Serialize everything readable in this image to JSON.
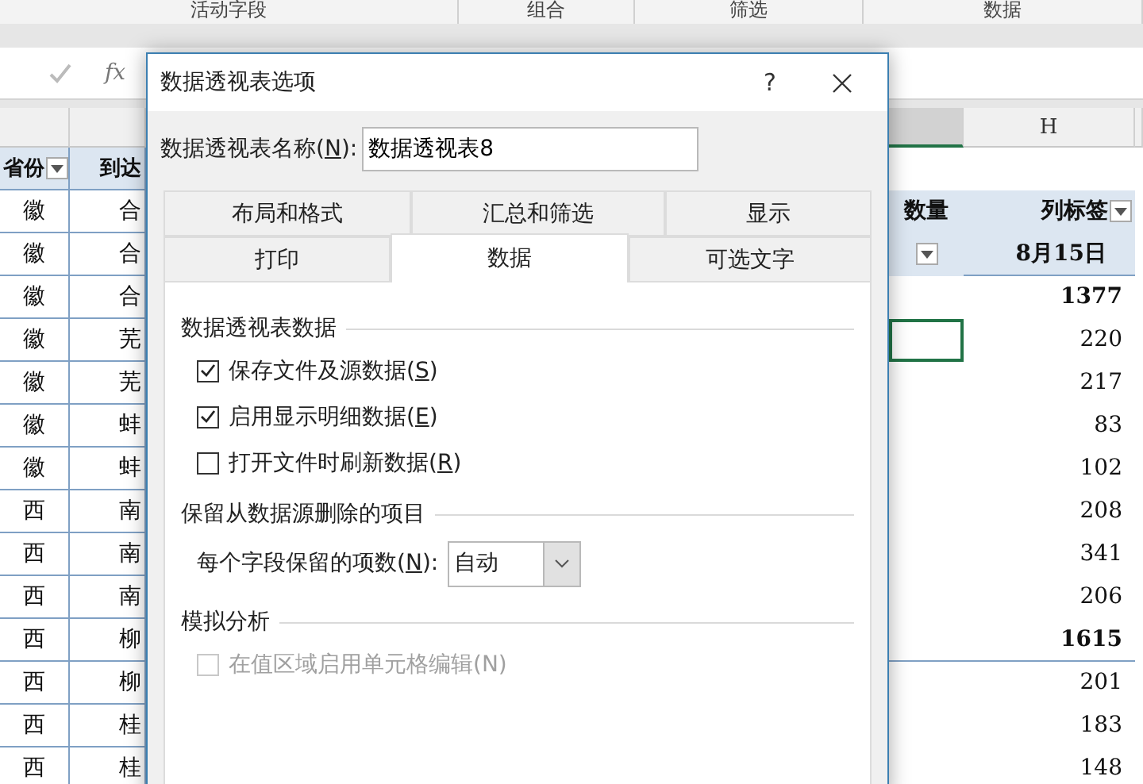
{
  "ribbon_groups": [
    "活动字段",
    "组合",
    "筛选",
    "数据"
  ],
  "formula_bar": {
    "function_label": "fx"
  },
  "left_table": {
    "headers": [
      {
        "text": "省份",
        "filter": true
      },
      {
        "text": "到达"
      }
    ],
    "rows": [
      [
        "徽",
        "合"
      ],
      [
        "徽",
        "合"
      ],
      [
        "徽",
        "合"
      ],
      [
        "徽",
        "芜"
      ],
      [
        "徽",
        "芜"
      ],
      [
        "徽",
        "蚌"
      ],
      [
        "徽",
        "蚌"
      ],
      [
        "西",
        "南"
      ],
      [
        "西",
        "南"
      ],
      [
        "西",
        "南"
      ],
      [
        "西",
        "柳"
      ],
      [
        "西",
        "柳"
      ],
      [
        "西",
        "桂"
      ],
      [
        "西",
        "桂"
      ]
    ]
  },
  "right_table": {
    "column_header": "H",
    "header_rows": [
      {
        "g_text": "数量",
        "h_text": "列标签",
        "h_filter": true
      },
      {
        "g_filter": true,
        "h_text": "8月15日"
      }
    ],
    "rows": [
      {
        "value": "1377",
        "bold": true,
        "selected": false
      },
      {
        "value": "220",
        "bold": false,
        "selected": true
      },
      {
        "value": "217",
        "bold": false,
        "selected": false
      },
      {
        "value": "83",
        "bold": false,
        "selected": false
      },
      {
        "value": "102",
        "bold": false,
        "selected": false
      },
      {
        "value": "208",
        "bold": false,
        "selected": false
      },
      {
        "value": "341",
        "bold": false,
        "selected": false
      },
      {
        "value": "206",
        "bold": false,
        "selected": false
      },
      {
        "value": "1615",
        "bold": true,
        "selected": false
      },
      {
        "value": "201",
        "bold": false,
        "selected": false
      },
      {
        "value": "183",
        "bold": false,
        "selected": false
      },
      {
        "value": "148",
        "bold": false,
        "selected": false
      }
    ]
  },
  "dialog": {
    "title": "数据透视表选项",
    "help": "?",
    "name_field": {
      "before": "数据透视表名称(",
      "accesskey": "N",
      "after": "):",
      "value": "数据透视表8"
    },
    "tab_rows": [
      [
        {
          "label": "布局和格式",
          "selected": false
        },
        {
          "label": "汇总和筛选",
          "selected": false
        },
        {
          "label": "显示",
          "selected": false
        }
      ],
      [
        {
          "label": "打印",
          "selected": false
        },
        {
          "label": "数据",
          "selected": true
        },
        {
          "label": "可选文字",
          "selected": false
        }
      ]
    ],
    "sections": [
      {
        "title": "数据透视表数据",
        "items": [
          {
            "kind": "checkbox",
            "before": "保存文件及源数据(",
            "accesskey": "S",
            "after": ")",
            "checked": true,
            "disabled": false
          },
          {
            "kind": "checkbox",
            "before": "启用显示明细数据(",
            "accesskey": "E",
            "after": ")",
            "checked": true,
            "disabled": false
          },
          {
            "kind": "checkbox",
            "before": "打开文件时刷新数据(",
            "accesskey": "R",
            "after": ")",
            "checked": false,
            "disabled": false
          }
        ]
      },
      {
        "title": "保留从数据源删除的项目",
        "items": [
          {
            "kind": "select",
            "before": "每个字段保留的项数(",
            "accesskey": "N",
            "after": "):",
            "value": "自动"
          }
        ]
      },
      {
        "title": "模拟分析",
        "items": [
          {
            "kind": "checkbox",
            "before": "在值区域启用单元格编辑(N)",
            "checked": false,
            "disabled": true
          }
        ]
      }
    ]
  }
}
